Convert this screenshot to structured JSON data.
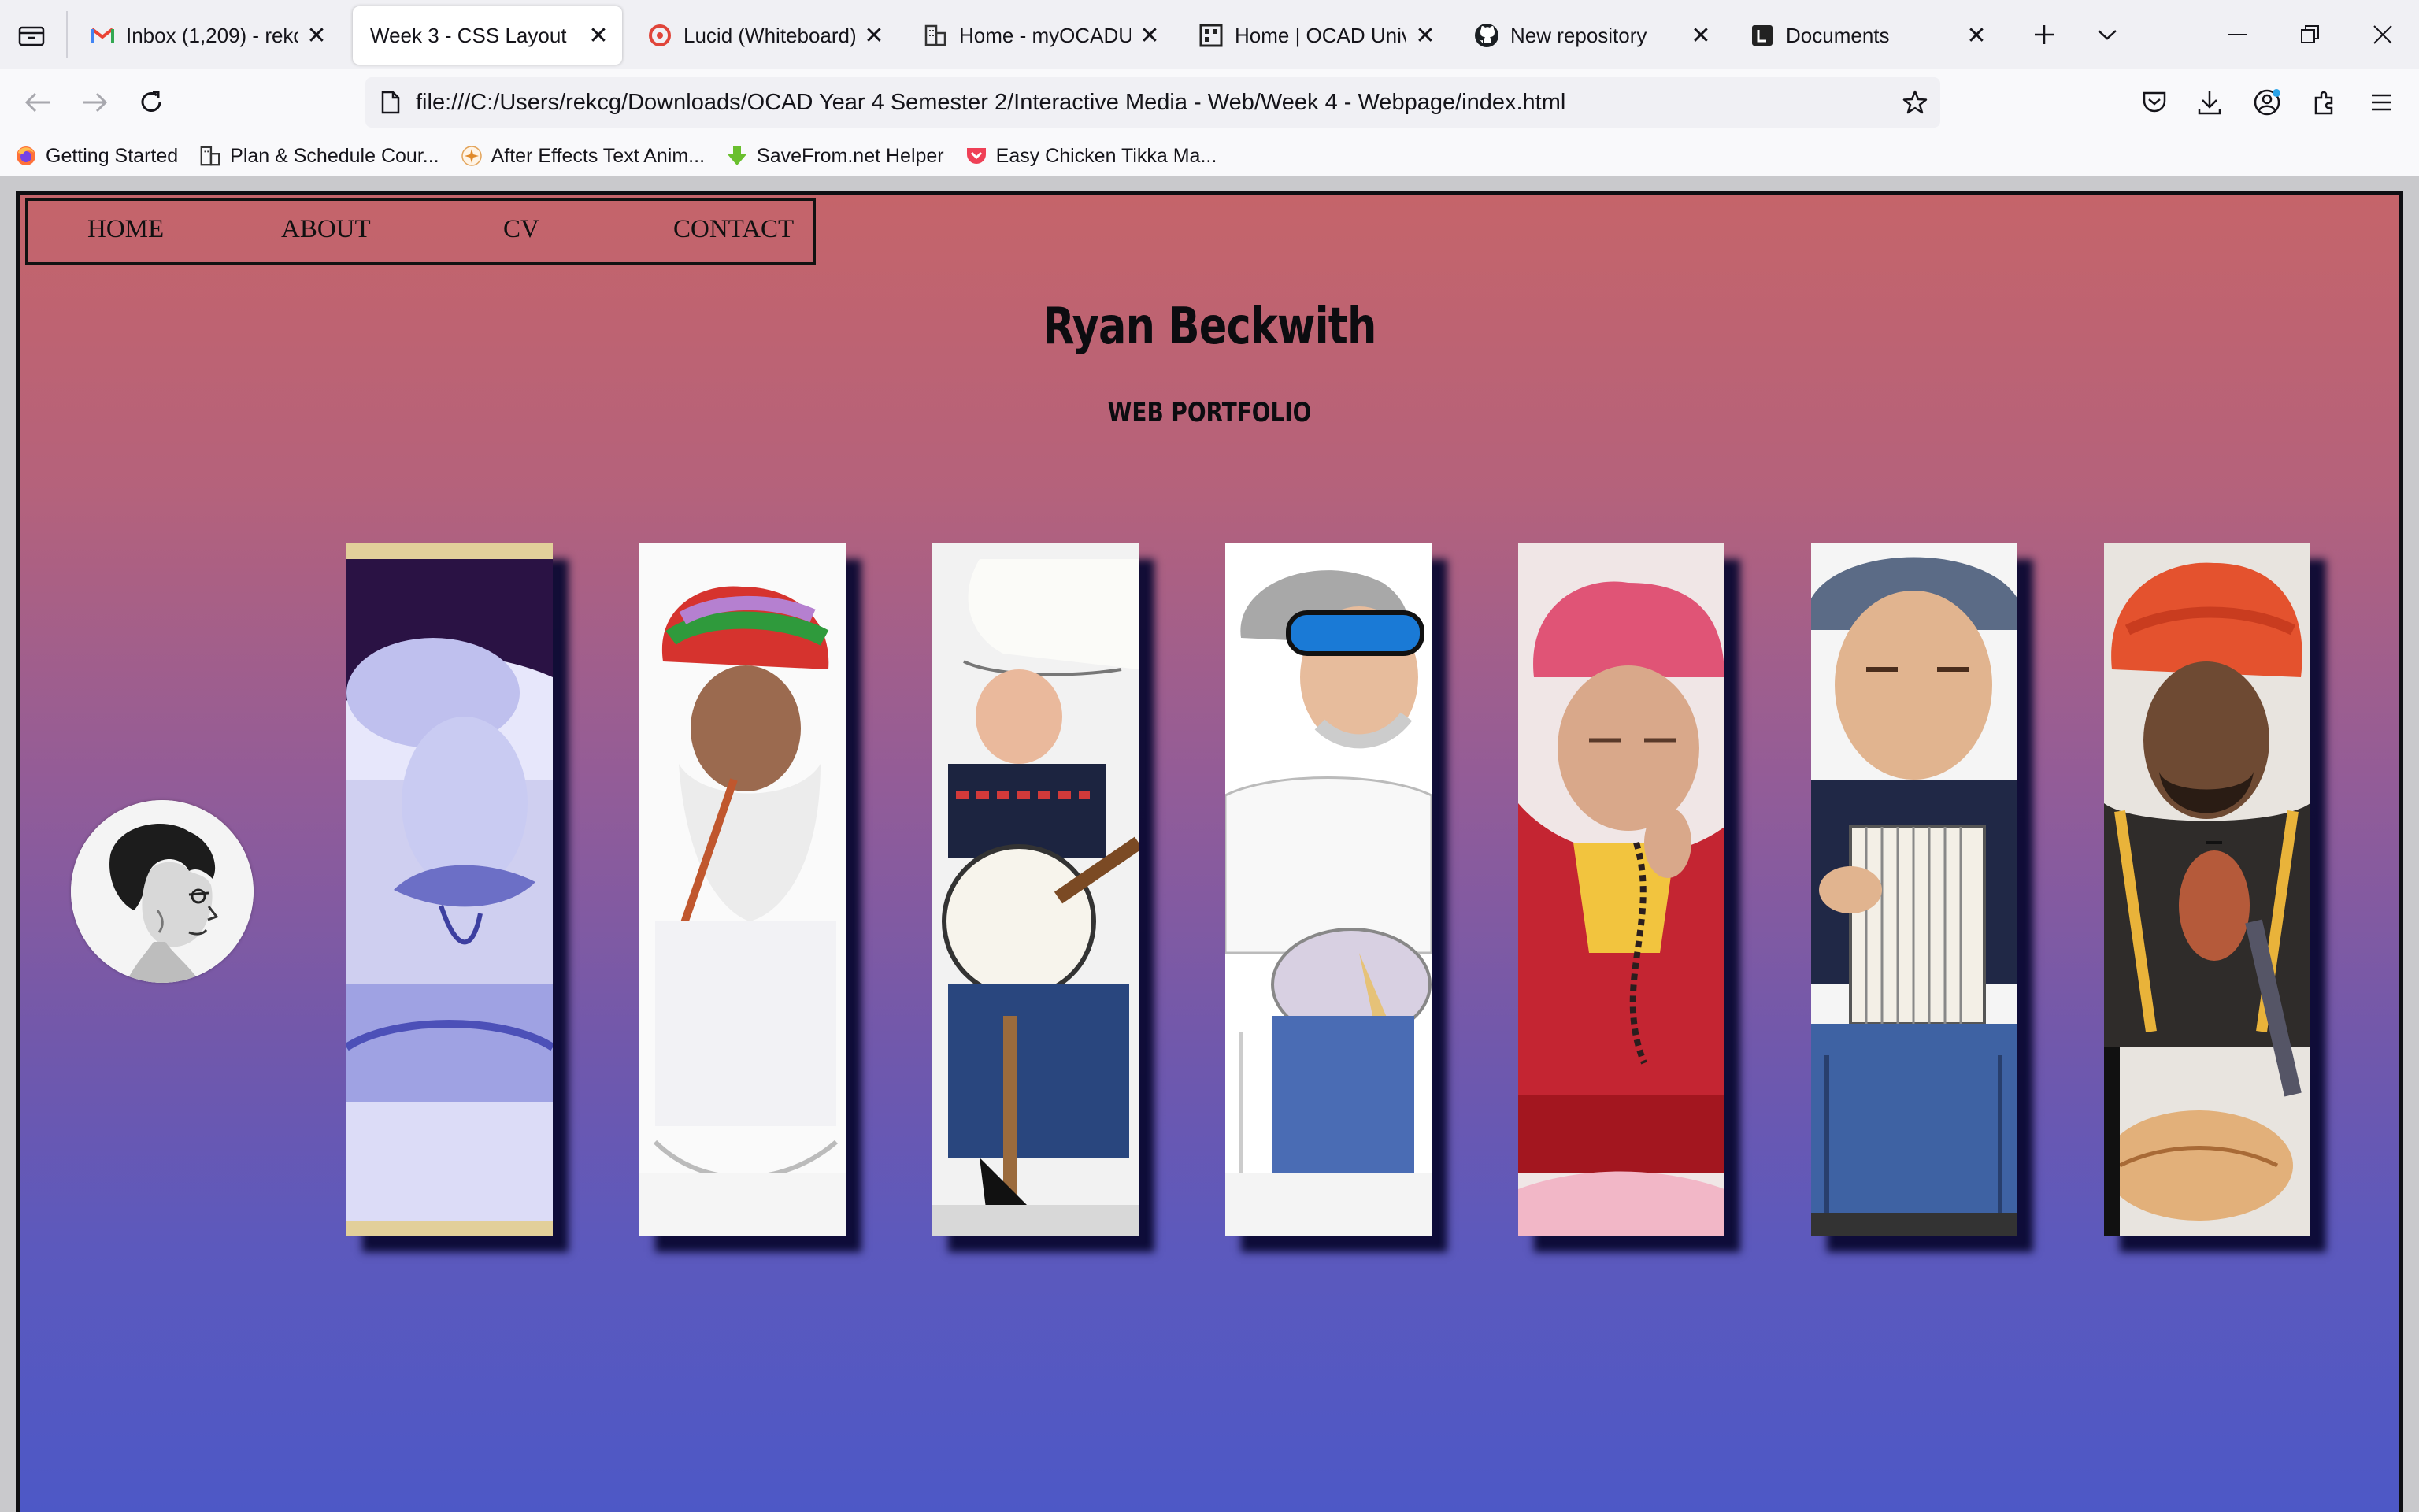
{
  "browser": {
    "tabs": [
      {
        "title": "Inbox (1,209) - rekcga",
        "icon": "gmail-icon",
        "active": false
      },
      {
        "title": "Week 3 - CSS Layout",
        "icon": "",
        "active": true
      },
      {
        "title": "Lucid (Whiteboard)",
        "icon": "lucid-icon",
        "active": false
      },
      {
        "title": "Home - myOCADU",
        "icon": "building-icon",
        "active": false
      },
      {
        "title": "Home | OCAD Universi",
        "icon": "ocad-icon",
        "active": false
      },
      {
        "title": "New repository",
        "icon": "github-icon",
        "active": false
      },
      {
        "title": "Documents",
        "icon": "documents-icon",
        "active": false
      }
    ],
    "url": "file:///C:/Users/rekcg/Downloads/OCAD Year 4 Semester 2/Interactive Media - Web/Week 4 - Webpage/index.html",
    "bookmarks": [
      {
        "label": "Getting Started",
        "icon": "firefox-icon"
      },
      {
        "label": "Plan & Schedule Cour...",
        "icon": "building-icon"
      },
      {
        "label": "After Effects Text Anim...",
        "icon": "sparkle-icon"
      },
      {
        "label": "SaveFrom.net Helper",
        "icon": "download-arrow-icon"
      },
      {
        "label": "Easy Chicken Tikka Ma...",
        "icon": "pocket-icon"
      }
    ]
  },
  "site": {
    "nav": [
      "HOME",
      "ABOUT",
      "CV",
      "CONTACT"
    ],
    "title": "Ryan Beckwith",
    "subtitle": "WEB PORTFOLIO",
    "illustrations": [
      {
        "subject": "blue-toned man with moustache and cap"
      },
      {
        "subject": "bearded man in colorful turban smoking pipe"
      },
      {
        "subject": "boy in cowboy hat playing banjo"
      },
      {
        "subject": "man in sunglasses playing guitar"
      },
      {
        "subject": "elderly monk in pink hat with prayer beads"
      },
      {
        "subject": "elderly man playing accordion"
      },
      {
        "subject": "man in orange turban playing flute"
      }
    ]
  },
  "colors": {
    "gradient_top": "#c5646a",
    "gradient_bottom": "#4d58c6"
  }
}
